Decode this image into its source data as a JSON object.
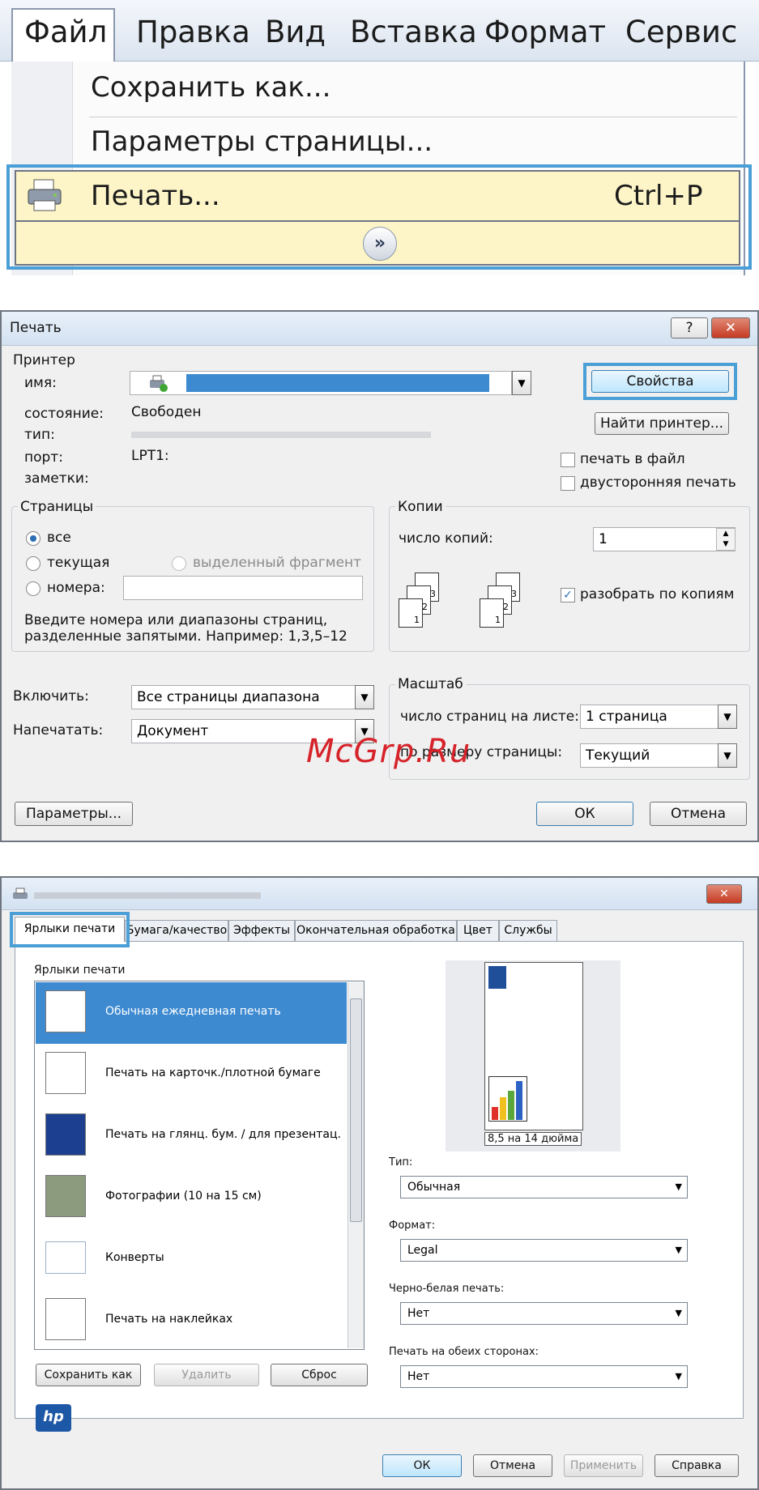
{
  "menu": {
    "items": [
      "Файл",
      "Правка",
      "Вид",
      "Вставка",
      "Формат",
      "Сервис"
    ],
    "dropdown": {
      "save_as": "Сохранить как...",
      "page_setup": "Параметры страницы...",
      "print": "Печать...",
      "print_shortcut": "Ctrl+P",
      "expand_icon": "double-chevron-down-icon"
    }
  },
  "print_dialog": {
    "title": "Печать",
    "help_button": "?",
    "close_button": "✕",
    "printer_group": "Принтер",
    "name_label": "имя:",
    "status_label": "состояние:",
    "status_value": "Свободен",
    "type_label": "тип:",
    "port_label": "порт:",
    "port_value": "LPT1:",
    "notes_label": "заметки:",
    "properties_button": "Свойства",
    "find_printer_button": "Найти принтер...",
    "print_to_file": "печать в файл",
    "duplex": "двусторонняя печать",
    "pages_group": "Страницы",
    "radio_all": "все",
    "radio_current": "текущая",
    "radio_selection": "выделенный фрагмент",
    "radio_pages": "номера:",
    "pages_hint_1": "Введите номера или диапазоны страниц,",
    "pages_hint_2": "разделенные запятыми. Например: 1,3,5–12",
    "copies_group": "Копии",
    "copies_label": "число копий:",
    "copies_value": "1",
    "collate": "разобрать по копиям",
    "include_label": "Включить:",
    "include_value": "Все страницы диапазона",
    "print_what_label": "Напечатать:",
    "print_what_value": "Документ",
    "scale_group": "Масштаб",
    "pages_per_sheet_label": "число страниц на листе:",
    "pages_per_sheet_value": "1 страница",
    "scale_to_paper_label": "по размеру страницы:",
    "scale_to_paper_value": "Текущий",
    "options_button": "Параметры...",
    "ok_button": "ОК",
    "cancel_button": "Отмена",
    "watermark": "McGrp.Ru"
  },
  "properties_dialog": {
    "tabs": [
      "Ярлыки печати",
      "Бумага/качество",
      "Эффекты",
      "Окончательная обработка",
      "Цвет",
      "Службы"
    ],
    "shortcuts_label": "Ярлыки печати",
    "shortcuts": [
      "Обычная ежедневная печать",
      "Печать на карточк./плотной бумаге",
      "Печать на глянц. бум. / для презентац.",
      "Фотографии (10 на 15 см)",
      "Конверты",
      "Печать на наклейках"
    ],
    "preview_caption": "8,5 на 14 дюйма",
    "type_label": "Тип:",
    "type_value": "Обычная",
    "format_label": "Формат:",
    "format_value": "Legal",
    "bw_label": "Черно-белая печать:",
    "bw_value": "Нет",
    "duplex_label": "Печать на обеих сторонах:",
    "duplex_value": "Нет",
    "save_as_button": "Сохранить как",
    "delete_button": "Удалить",
    "reset_button": "Сброс",
    "ok_button": "ОК",
    "cancel_button": "Отмена",
    "apply_button": "Применить",
    "help_button": "Справка",
    "close_button": "✕",
    "logo_text": "hp"
  },
  "colors": {
    "highlight_border": "#4a9fd6",
    "menu_highlight": "#fdf5c8",
    "selection": "#3d8ad1",
    "close_red": "#c9422f"
  }
}
